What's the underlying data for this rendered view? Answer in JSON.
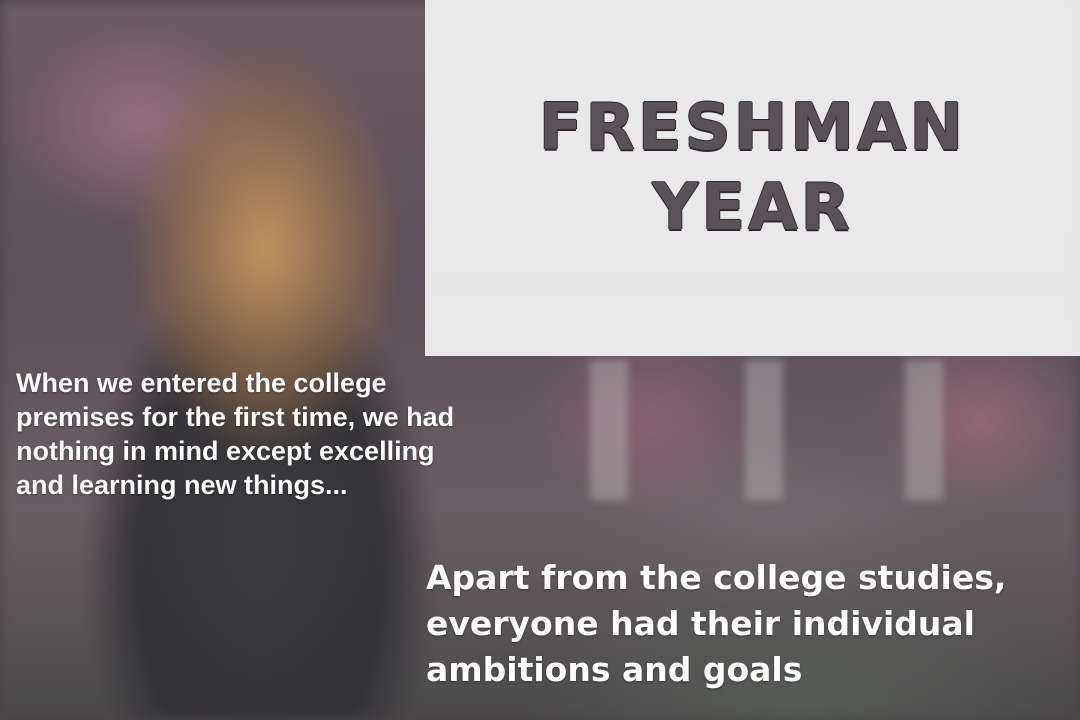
{
  "title": {
    "line1": "FRESHMAN",
    "line2": "YEAR"
  },
  "intro_text": "When we entered the college premises for the first time, we had nothing in mind except excelling and learning new things...",
  "caption_text": "Apart from the college studies, everyone had their individual ambitions and goals",
  "colors": {
    "panel_bg": "#f4f4f4",
    "title_fill": "#5a5259",
    "title_outline": "#2f2a2e",
    "text_white": "#ffffff"
  }
}
